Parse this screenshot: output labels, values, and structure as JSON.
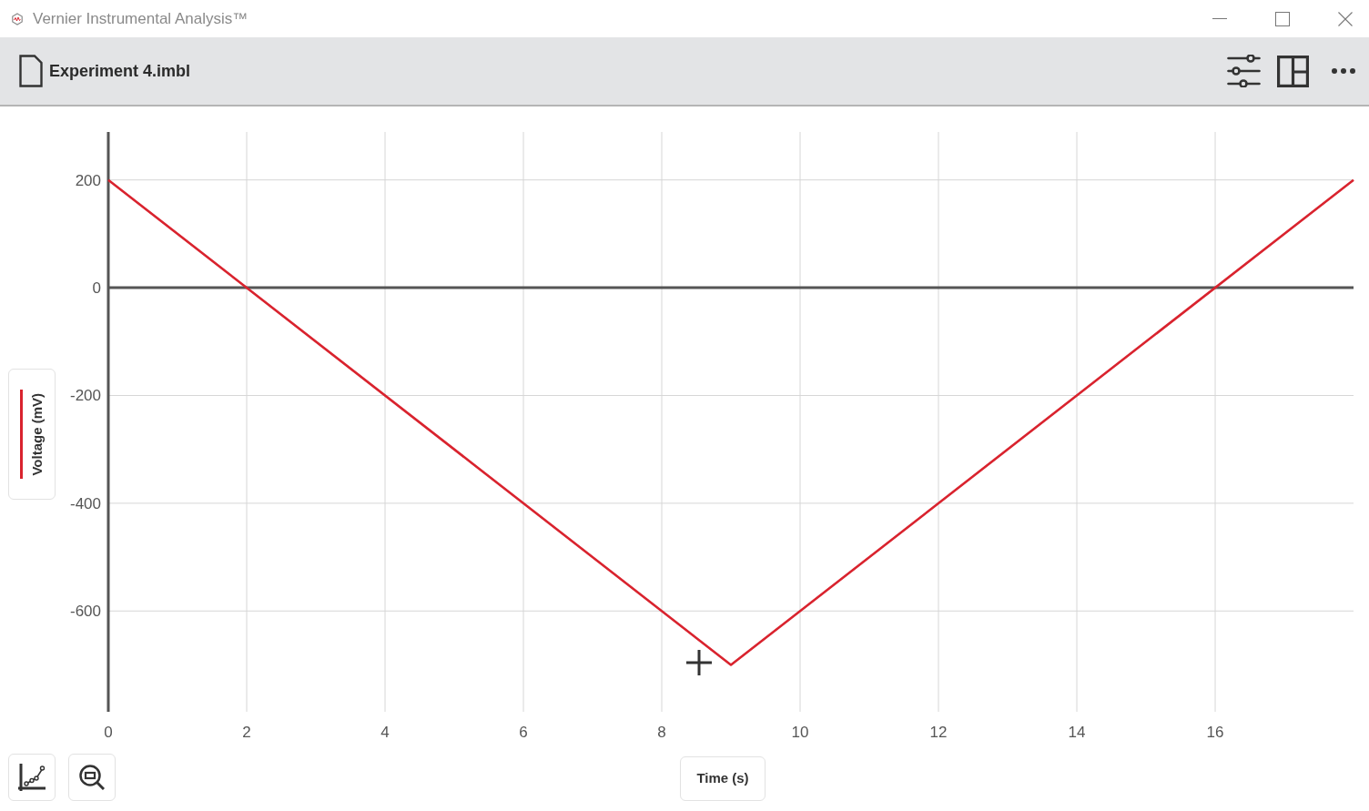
{
  "window": {
    "title": "Vernier Instrumental Analysis™"
  },
  "toolbar": {
    "document_title": "Experiment 4.imbl"
  },
  "graph": {
    "chart_data": {
      "type": "line",
      "xlabel": "Time (s)",
      "ylabel": "Voltage (mV)",
      "x": [
        0,
        9,
        18
      ],
      "series": [
        {
          "color": "#d9232e",
          "values": [
            200,
            -700,
            200
          ]
        }
      ],
      "xlim": [
        0,
        18
      ],
      "ylim": [
        -787,
        289
      ],
      "xticks": [
        0,
        2,
        4,
        6,
        8,
        10,
        12,
        14,
        16
      ],
      "yticks": [
        -600,
        -400,
        -200,
        0,
        200
      ],
      "grid": true
    }
  }
}
